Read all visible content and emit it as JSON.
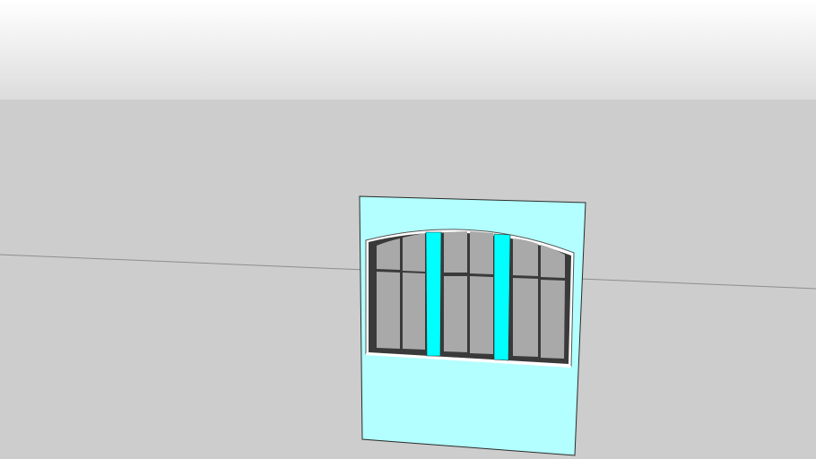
{
  "viewport": {
    "sky_top_color": "#ffffff",
    "sky_bottom_color": "#dcdcdc",
    "ground_color": "#cdcdcd",
    "wall_color": "#b3fefe",
    "glass_color": "#a9a9a9",
    "frame_color": "#3a3a3a",
    "accent_bar_color": "#00ffff",
    "edge_color": "#2b2b2b"
  }
}
